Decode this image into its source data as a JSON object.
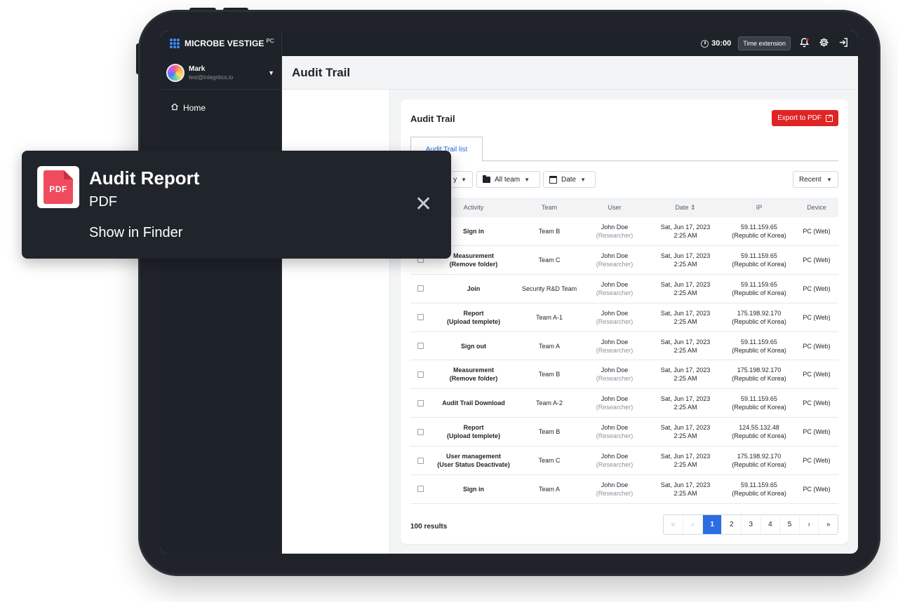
{
  "app": {
    "brand": "MICROBE VESTIGE",
    "brand_suffix": "PC",
    "timer": "30:00",
    "time_extension": "Time extension"
  },
  "sidebar": {
    "user_name": "Mark",
    "user_email": "test@integritics.io",
    "home_label": "Home"
  },
  "page": {
    "title": "Audit Trail"
  },
  "card": {
    "title": "Audit Trail",
    "export_label": "Export to PDF",
    "tab_label": "Audit Trail list"
  },
  "filters": {
    "activity": "y",
    "team": "All team",
    "date": "Date",
    "sort": "Recent"
  },
  "table": {
    "headers": {
      "activity": "Activity",
      "team": "Team",
      "user": "User",
      "date": "Date",
      "ip": "IP",
      "device": "Device"
    },
    "rows": [
      {
        "act1": "Sign in",
        "act2": "",
        "team": "Team B",
        "user": "John Doe",
        "role": "(Researcher)",
        "date1": "Sat, Jun 17, 2023",
        "date2": "2:25 AM",
        "ip1": "59.11.159.65",
        "ip2": "(Republic of Korea)",
        "device": "PC (Web)"
      },
      {
        "act1": "Measurement",
        "act2": "(Remove folder)",
        "team": "Team C",
        "user": "John Doe",
        "role": "(Researcher)",
        "date1": "Sat, Jun 17, 2023",
        "date2": "2:25 AM",
        "ip1": "59.11.159.65",
        "ip2": "(Republic of Korea)",
        "device": "PC (Web)"
      },
      {
        "act1": "Join",
        "act2": "",
        "team": "Security R&D Team",
        "user": "John Doe",
        "role": "(Researcher)",
        "date1": "Sat, Jun 17, 2023",
        "date2": "2:25 AM",
        "ip1": "59.11.159.65",
        "ip2": "(Republic of Korea)",
        "device": "PC (Web)"
      },
      {
        "act1": "Report",
        "act2": "(Upload templete)",
        "team": "Team A-1",
        "user": "John Doe",
        "role": "(Researcher)",
        "date1": "Sat, Jun 17, 2023",
        "date2": "2:25 AM",
        "ip1": "175.198.92.170",
        "ip2": "(Republic of Korea)",
        "device": "PC (Web)"
      },
      {
        "act1": "Sign out",
        "act2": "",
        "team": "Team A",
        "user": "John Doe",
        "role": "(Researcher)",
        "date1": "Sat, Jun 17, 2023",
        "date2": "2:25 AM",
        "ip1": "59.11.159.65",
        "ip2": "(Republic of Korea)",
        "device": "PC (Web)"
      },
      {
        "act1": "Measurement",
        "act2": "(Remove folder)",
        "team": "Team B",
        "user": "John Doe",
        "role": "(Researcher)",
        "date1": "Sat, Jun 17, 2023",
        "date2": "2:25 AM",
        "ip1": "175.198.92.170",
        "ip2": "(Republic of Korea)",
        "device": "PC (Web)"
      },
      {
        "act1": "Audit Trail Download",
        "act2": "",
        "team": "Team A-2",
        "user": "John Doe",
        "role": "(Researcher)",
        "date1": "Sat, Jun 17, 2023",
        "date2": "2:25 AM",
        "ip1": "59.11.159.65",
        "ip2": "(Republic of Korea)",
        "device": "PC (Web)"
      },
      {
        "act1": "Report",
        "act2": "(Upload templete)",
        "team": "Team B",
        "user": "John Doe",
        "role": "(Researcher)",
        "date1": "Sat, Jun 17, 2023",
        "date2": "2:25 AM",
        "ip1": "124.55.132.48",
        "ip2": "(Republic of Korea)",
        "device": "PC (Web)"
      },
      {
        "act1": "User management",
        "act2": "(User Status Deactivate)",
        "team": "Team C",
        "user": "John Doe",
        "role": "(Researcher)",
        "date1": "Sat, Jun 17, 2023",
        "date2": "2:25 AM",
        "ip1": "175.198.92.170",
        "ip2": "(Republic of Korea)",
        "device": "PC (Web)"
      },
      {
        "act1": "Sign in",
        "act2": "",
        "team": "Team A",
        "user": "John Doe",
        "role": "(Researcher)",
        "date1": "Sat, Jun 17, 2023",
        "date2": "2:25 AM",
        "ip1": "59.11.159.65",
        "ip2": "(Republic of Korea)",
        "device": "PC (Web)"
      }
    ]
  },
  "pagination": {
    "results": "100 results",
    "pages": [
      "1",
      "2",
      "3",
      "4",
      "5"
    ],
    "current": "1"
  },
  "notification": {
    "icon_label": "PDF",
    "title": "Audit Report",
    "subtitle": "PDF",
    "action": "Show in Finder"
  },
  "colors": {
    "accent": "#2b6de3",
    "danger": "#e02424",
    "dark": "#1e2229"
  },
  "icons": [
    "clock-icon",
    "bell-icon",
    "gear-icon",
    "logout-icon",
    "home-icon",
    "chevron-down-icon",
    "folder-icon",
    "calendar-icon",
    "external-link-icon",
    "sort-icon",
    "close-icon",
    "pdf-file-icon"
  ]
}
